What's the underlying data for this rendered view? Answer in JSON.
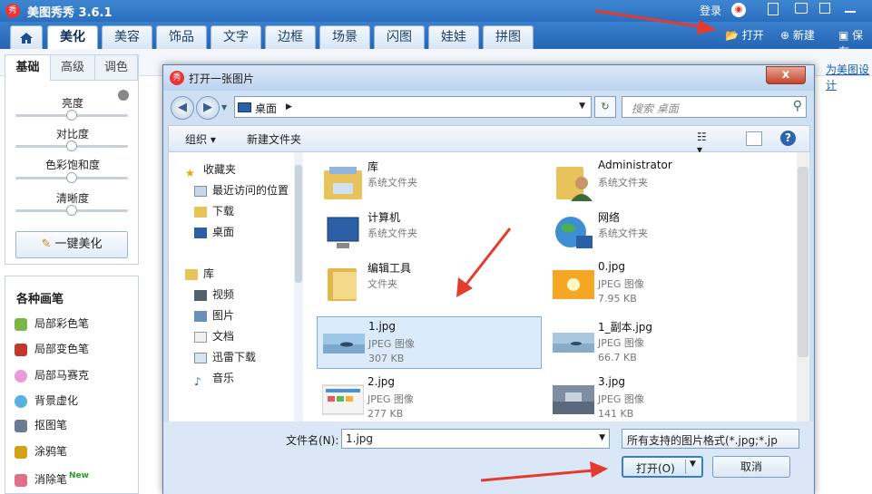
{
  "app": {
    "title": "美图秀秀 3.6.1",
    "logo_text": "秀",
    "login": "登录",
    "tabs": [
      "美化",
      "美容",
      "饰品",
      "文字",
      "边框",
      "场景",
      "闪图",
      "娃娃",
      "拼图"
    ],
    "toolbar": {
      "open": "打开",
      "new": "新建",
      "save": "保存"
    },
    "link": "为美图设计"
  },
  "left_panel": {
    "tabs": [
      "基础",
      "高级",
      "调色"
    ],
    "sliders": [
      {
        "label": "亮度",
        "value": 0.5
      },
      {
        "label": "对比度",
        "value": 0.5
      },
      {
        "label": "色彩饱和度",
        "value": 0.5
      },
      {
        "label": "清晰度",
        "value": 0.5
      }
    ],
    "one_key": "一键美化"
  },
  "brush_panel": {
    "title": "各种画笔",
    "items": [
      {
        "label": "局部彩色笔",
        "color": "#7ab648"
      },
      {
        "label": "局部变色笔",
        "color": "#c0392b"
      },
      {
        "label": "局部马赛克",
        "color": "#e89bd6"
      },
      {
        "label": "背景虚化",
        "color": "#5ab0e0"
      },
      {
        "label": "抠图笔",
        "color": "#6a7c93"
      },
      {
        "label": "涂鸦笔",
        "color": "#d4a017"
      },
      {
        "label": "消除笔",
        "color": "#e0708a",
        "badge": "New"
      }
    ]
  },
  "dialog": {
    "title": "打开一张图片",
    "close": "x",
    "address": "桌面",
    "search_placeholder": "搜索 桌面",
    "toolbar": {
      "organize": "组织 ▾",
      "new_folder": "新建文件夹"
    },
    "nav": [
      {
        "label": "收藏夹",
        "icon": "star-icon"
      },
      {
        "label": "最近访问的位置",
        "icon": "recent-icon"
      },
      {
        "label": "下载",
        "icon": "download-icon"
      },
      {
        "label": "桌面",
        "icon": "desktop-icon"
      },
      {
        "label": "库",
        "icon": "library-icon"
      },
      {
        "label": "视频",
        "icon": "video-icon"
      },
      {
        "label": "图片",
        "icon": "picture-icon"
      },
      {
        "label": "文档",
        "icon": "document-icon"
      },
      {
        "label": "迅雷下载",
        "icon": "thunder-icon"
      },
      {
        "label": "音乐",
        "icon": "music-icon"
      }
    ],
    "files": [
      {
        "name": "库",
        "type": "系统文件夹",
        "size": ""
      },
      {
        "name": "Administrator",
        "type": "系统文件夹",
        "size": ""
      },
      {
        "name": "计算机",
        "type": "系统文件夹",
        "size": ""
      },
      {
        "name": "网络",
        "type": "系统文件夹",
        "size": ""
      },
      {
        "name": "编辑工具",
        "type": "文件夹",
        "size": ""
      },
      {
        "name": "0.jpg",
        "type": "JPEG 图像",
        "size": "7.95 KB"
      },
      {
        "name": "1.jpg",
        "type": "JPEG 图像",
        "size": "307 KB",
        "selected": true
      },
      {
        "name": "1_副本.jpg",
        "type": "JPEG 图像",
        "size": "66.7 KB"
      },
      {
        "name": "2.jpg",
        "type": "JPEG 图像",
        "size": "277 KB"
      },
      {
        "name": "3.jpg",
        "type": "JPEG 图像",
        "size": "141 KB"
      }
    ],
    "filename_label": "文件名(N):",
    "filename_value": "1.jpg",
    "filetype_value": "所有支持的图片格式(*.jpg;*.jp",
    "open_button": "打开(O)",
    "cancel_button": "取消"
  }
}
